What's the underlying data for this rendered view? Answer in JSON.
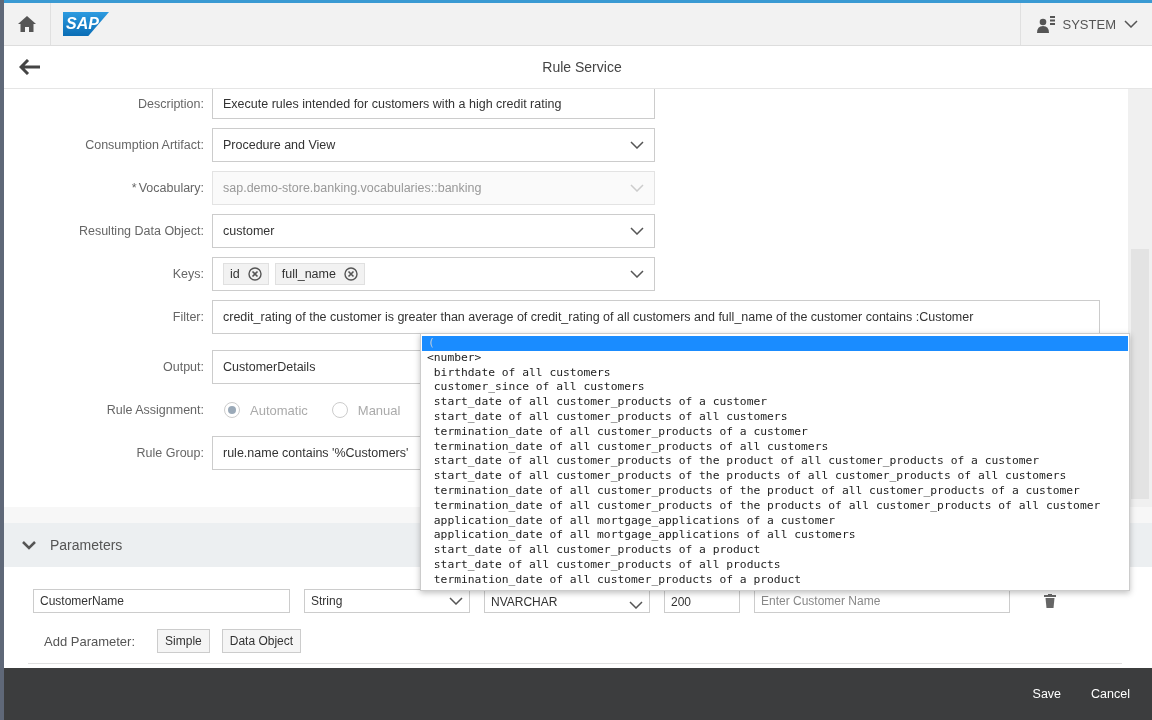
{
  "shell": {
    "logo_text": "SAP",
    "user": "SYSTEM"
  },
  "header": {
    "title": "Rule Service"
  },
  "form": {
    "fields": [
      {
        "kind": "text",
        "label": "Description:",
        "value": "Execute rules intended for customers with a high credit rating"
      },
      {
        "kind": "select",
        "label": "Consumption Artifact:",
        "value": "Procedure and View"
      },
      {
        "kind": "select",
        "label": "Vocabulary:",
        "required_mark": "*",
        "disabled": true,
        "value": "sap.demo-store.banking.vocabularies::banking"
      },
      {
        "kind": "select",
        "label": "Resulting Data Object:",
        "value": "customer"
      },
      {
        "kind": "tokens",
        "label": "Keys:",
        "tokens": [
          "id",
          "full_name"
        ]
      },
      {
        "kind": "wide",
        "label": "Filter:",
        "value": "credit_rating of the customer is greater than average of credit_rating of all customers and full_name of the customer contains :Customer"
      },
      {
        "kind": "text",
        "label": "Output:",
        "value": "CustomerDetails"
      },
      {
        "kind": "radio",
        "label": "Rule Assignment:",
        "disabled": true,
        "options": [
          {
            "label": "Automatic",
            "selected": true
          },
          {
            "label": "Manual",
            "selected": false
          }
        ]
      },
      {
        "kind": "text",
        "label": "Rule Group:",
        "value": "rule.name contains '%Customers'"
      }
    ]
  },
  "parameters": {
    "title": "Parameters",
    "expanded": true,
    "row": {
      "name": "CustomerName",
      "type": "String",
      "sql_type": "NVARCHAR",
      "length": "200",
      "description_placeholder": "Enter Customer Name"
    },
    "add_label": "Add Parameter:",
    "add_buttons": [
      "Simple",
      "Data Object"
    ]
  },
  "suggestions": [
    {
      "text": "(",
      "selected": true
    },
    {
      "text": "<number>",
      "selected": false
    },
    {
      "text": " birthdate of all customers",
      "selected": false
    },
    {
      "text": " customer_since of all customers",
      "selected": false
    },
    {
      "text": " start_date of all customer_products of a customer",
      "selected": false
    },
    {
      "text": " start_date of all customer_products of all customers",
      "selected": false
    },
    {
      "text": " termination_date of all customer_products of a customer",
      "selected": false
    },
    {
      "text": " termination_date of all customer_products of all customers",
      "selected": false
    },
    {
      "text": " start_date of all customer_products of the product of all customer_products of a customer",
      "selected": false
    },
    {
      "text": " start_date of all customer_products of the products of all customer_products of all customers",
      "selected": false
    },
    {
      "text": " termination_date of all customer_products of the product of all customer_products of a customer",
      "selected": false
    },
    {
      "text": " termination_date of all customer_products of the products of all customer_products of all customer",
      "selected": false
    },
    {
      "text": " application_date of all mortgage_applications of a customer",
      "selected": false
    },
    {
      "text": " application_date of all mortgage_applications of all customers",
      "selected": false
    },
    {
      "text": " start_date of all customer_products of a product",
      "selected": false
    },
    {
      "text": " start_date of all customer_products of all products",
      "selected": false
    },
    {
      "text": " termination_date of all customer_products of a product",
      "selected": false
    }
  ],
  "footer": {
    "buttons": [
      "Save",
      "Cancel"
    ]
  }
}
